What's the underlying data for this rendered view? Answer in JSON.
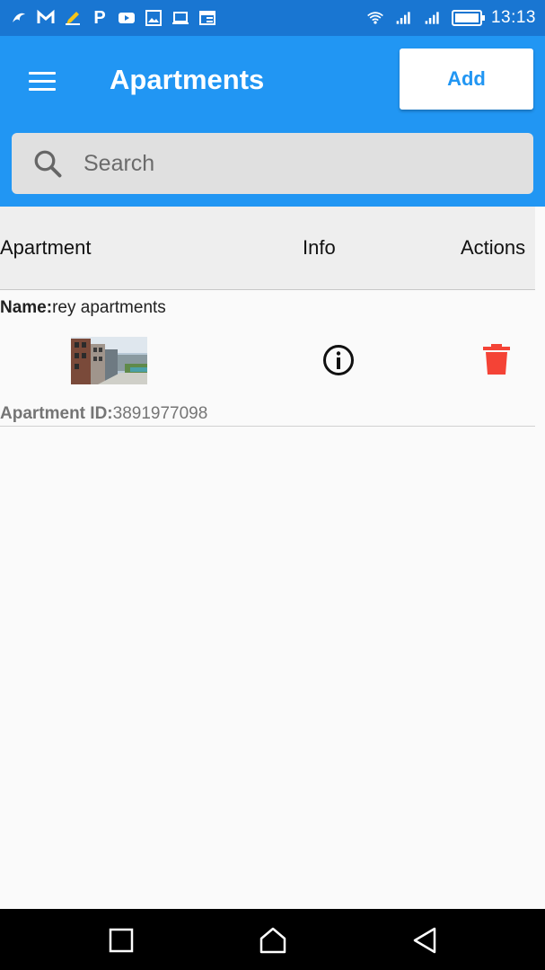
{
  "status_bar": {
    "notification_icons": [
      "swift-icon",
      "gmail-icon",
      "pencil-icon",
      "paytm-icon",
      "youtube-icon",
      "gallery-icon",
      "laptop-icon",
      "browser-icon"
    ],
    "time": "13:13"
  },
  "app_bar": {
    "title": "Apartments",
    "add_label": "Add",
    "colors": {
      "primary": "#2196f3",
      "primary_dark": "#1976d2"
    }
  },
  "search": {
    "placeholder": "Search"
  },
  "table": {
    "headers": {
      "apartment": "Apartment",
      "info": "Info",
      "actions": "Actions"
    },
    "rows": [
      {
        "name_label": "Name:",
        "name": "rey apartments",
        "id_label": "Apartment ID:",
        "id": "3891977098"
      }
    ]
  },
  "colors": {
    "delete": "#f44336"
  }
}
